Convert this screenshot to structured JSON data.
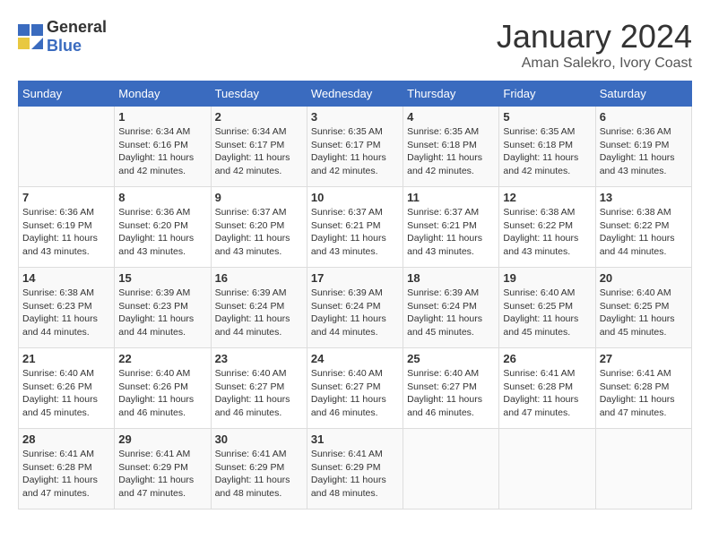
{
  "header": {
    "logo_general": "General",
    "logo_blue": "Blue",
    "title": "January 2024",
    "subtitle": "Aman Salekro, Ivory Coast"
  },
  "days_of_week": [
    "Sunday",
    "Monday",
    "Tuesday",
    "Wednesday",
    "Thursday",
    "Friday",
    "Saturday"
  ],
  "weeks": [
    [
      {
        "day": "",
        "info": ""
      },
      {
        "day": "1",
        "info": "Sunrise: 6:34 AM\nSunset: 6:16 PM\nDaylight: 11 hours and 42 minutes."
      },
      {
        "day": "2",
        "info": "Sunrise: 6:34 AM\nSunset: 6:17 PM\nDaylight: 11 hours and 42 minutes."
      },
      {
        "day": "3",
        "info": "Sunrise: 6:35 AM\nSunset: 6:17 PM\nDaylight: 11 hours and 42 minutes."
      },
      {
        "day": "4",
        "info": "Sunrise: 6:35 AM\nSunset: 6:18 PM\nDaylight: 11 hours and 42 minutes."
      },
      {
        "day": "5",
        "info": "Sunrise: 6:35 AM\nSunset: 6:18 PM\nDaylight: 11 hours and 42 minutes."
      },
      {
        "day": "6",
        "info": "Sunrise: 6:36 AM\nSunset: 6:19 PM\nDaylight: 11 hours and 43 minutes."
      }
    ],
    [
      {
        "day": "7",
        "info": "Sunrise: 6:36 AM\nSunset: 6:19 PM\nDaylight: 11 hours and 43 minutes."
      },
      {
        "day": "8",
        "info": "Sunrise: 6:36 AM\nSunset: 6:20 PM\nDaylight: 11 hours and 43 minutes."
      },
      {
        "day": "9",
        "info": "Sunrise: 6:37 AM\nSunset: 6:20 PM\nDaylight: 11 hours and 43 minutes."
      },
      {
        "day": "10",
        "info": "Sunrise: 6:37 AM\nSunset: 6:21 PM\nDaylight: 11 hours and 43 minutes."
      },
      {
        "day": "11",
        "info": "Sunrise: 6:37 AM\nSunset: 6:21 PM\nDaylight: 11 hours and 43 minutes."
      },
      {
        "day": "12",
        "info": "Sunrise: 6:38 AM\nSunset: 6:22 PM\nDaylight: 11 hours and 43 minutes."
      },
      {
        "day": "13",
        "info": "Sunrise: 6:38 AM\nSunset: 6:22 PM\nDaylight: 11 hours and 44 minutes."
      }
    ],
    [
      {
        "day": "14",
        "info": "Sunrise: 6:38 AM\nSunset: 6:23 PM\nDaylight: 11 hours and 44 minutes."
      },
      {
        "day": "15",
        "info": "Sunrise: 6:39 AM\nSunset: 6:23 PM\nDaylight: 11 hours and 44 minutes."
      },
      {
        "day": "16",
        "info": "Sunrise: 6:39 AM\nSunset: 6:24 PM\nDaylight: 11 hours and 44 minutes."
      },
      {
        "day": "17",
        "info": "Sunrise: 6:39 AM\nSunset: 6:24 PM\nDaylight: 11 hours and 44 minutes."
      },
      {
        "day": "18",
        "info": "Sunrise: 6:39 AM\nSunset: 6:24 PM\nDaylight: 11 hours and 45 minutes."
      },
      {
        "day": "19",
        "info": "Sunrise: 6:40 AM\nSunset: 6:25 PM\nDaylight: 11 hours and 45 minutes."
      },
      {
        "day": "20",
        "info": "Sunrise: 6:40 AM\nSunset: 6:25 PM\nDaylight: 11 hours and 45 minutes."
      }
    ],
    [
      {
        "day": "21",
        "info": "Sunrise: 6:40 AM\nSunset: 6:26 PM\nDaylight: 11 hours and 45 minutes."
      },
      {
        "day": "22",
        "info": "Sunrise: 6:40 AM\nSunset: 6:26 PM\nDaylight: 11 hours and 46 minutes."
      },
      {
        "day": "23",
        "info": "Sunrise: 6:40 AM\nSunset: 6:27 PM\nDaylight: 11 hours and 46 minutes."
      },
      {
        "day": "24",
        "info": "Sunrise: 6:40 AM\nSunset: 6:27 PM\nDaylight: 11 hours and 46 minutes."
      },
      {
        "day": "25",
        "info": "Sunrise: 6:40 AM\nSunset: 6:27 PM\nDaylight: 11 hours and 46 minutes."
      },
      {
        "day": "26",
        "info": "Sunrise: 6:41 AM\nSunset: 6:28 PM\nDaylight: 11 hours and 47 minutes."
      },
      {
        "day": "27",
        "info": "Sunrise: 6:41 AM\nSunset: 6:28 PM\nDaylight: 11 hours and 47 minutes."
      }
    ],
    [
      {
        "day": "28",
        "info": "Sunrise: 6:41 AM\nSunset: 6:28 PM\nDaylight: 11 hours and 47 minutes."
      },
      {
        "day": "29",
        "info": "Sunrise: 6:41 AM\nSunset: 6:29 PM\nDaylight: 11 hours and 47 minutes."
      },
      {
        "day": "30",
        "info": "Sunrise: 6:41 AM\nSunset: 6:29 PM\nDaylight: 11 hours and 48 minutes."
      },
      {
        "day": "31",
        "info": "Sunrise: 6:41 AM\nSunset: 6:29 PM\nDaylight: 11 hours and 48 minutes."
      },
      {
        "day": "",
        "info": ""
      },
      {
        "day": "",
        "info": ""
      },
      {
        "day": "",
        "info": ""
      }
    ]
  ]
}
